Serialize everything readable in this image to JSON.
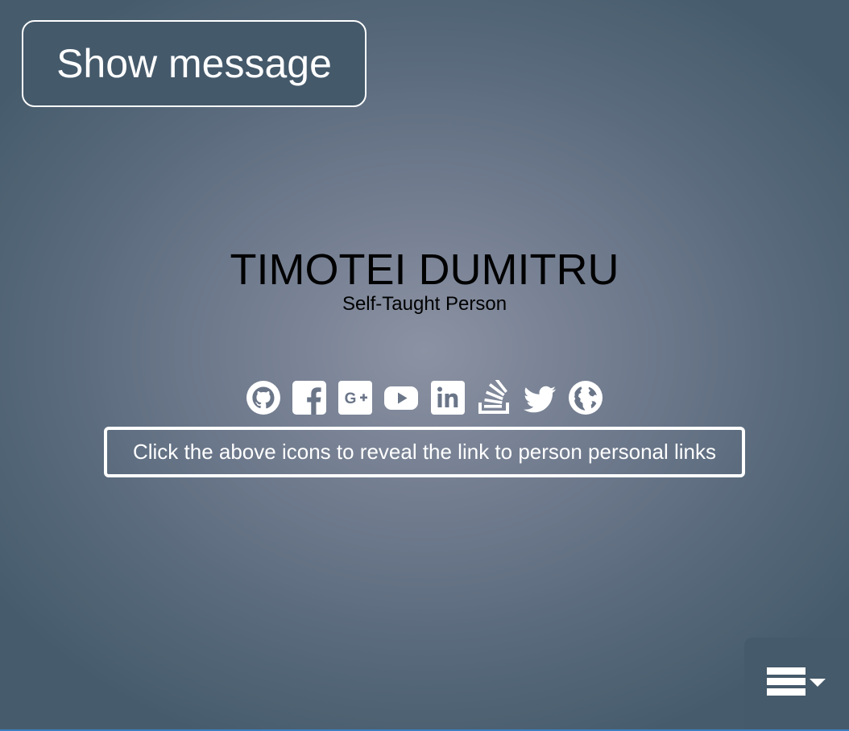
{
  "show_message_button": {
    "label": "Show message"
  },
  "profile": {
    "name": "TIMOTEI DUMITRU",
    "subtitle": "Self-Taught Person"
  },
  "social_icons": [
    "github-icon",
    "facebook-icon",
    "google-plus-icon",
    "youtube-icon",
    "linkedin-icon",
    "stackoverflow-icon",
    "twitter-icon",
    "globe-icon"
  ],
  "hint": {
    "text": "Click the above icons to reveal the link to person personal links"
  },
  "menu": {
    "icon": "hamburger-menu-icon"
  },
  "colors": {
    "button_bg": "#44596a",
    "menu_bg": "#455a6a",
    "border": "#ffffff",
    "text_dark": "#000000",
    "text_light": "#ffffff"
  }
}
